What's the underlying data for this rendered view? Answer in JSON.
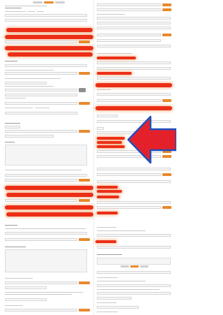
{
  "page": {
    "tabs": [
      {
        "label": "",
        "state": "inactive"
      },
      {
        "label": "",
        "state": "active"
      },
      {
        "label": "",
        "state": "inactive"
      }
    ]
  },
  "left_column": {
    "sections": [
      {
        "title": "",
        "fields": [
          "",
          "",
          "",
          ""
        ]
      },
      {
        "title": "",
        "fields": [
          "",
          "",
          ""
        ]
      },
      {
        "title": "",
        "fields": [
          "",
          "",
          ""
        ]
      },
      {
        "title": "",
        "fields": [
          "",
          ""
        ]
      }
    ]
  },
  "right_column": {
    "sections": [
      {
        "title": "",
        "fields": [
          "",
          "",
          ""
        ]
      },
      {
        "title": "",
        "fields": [
          "",
          "",
          ""
        ]
      },
      {
        "title": "",
        "fields": [
          "",
          "",
          ""
        ]
      }
    ]
  },
  "annotations": {
    "redaction_color": "#ec2e17",
    "arrow_fill": "#e4212b",
    "arrow_stroke": "#1f4fbf",
    "arrow_direction": "left"
  },
  "colors": {
    "accent_button": "#e8892c",
    "field_border": "#d6d6d6",
    "field_background": "#f7f7f7",
    "divider": "#eeeeee"
  }
}
